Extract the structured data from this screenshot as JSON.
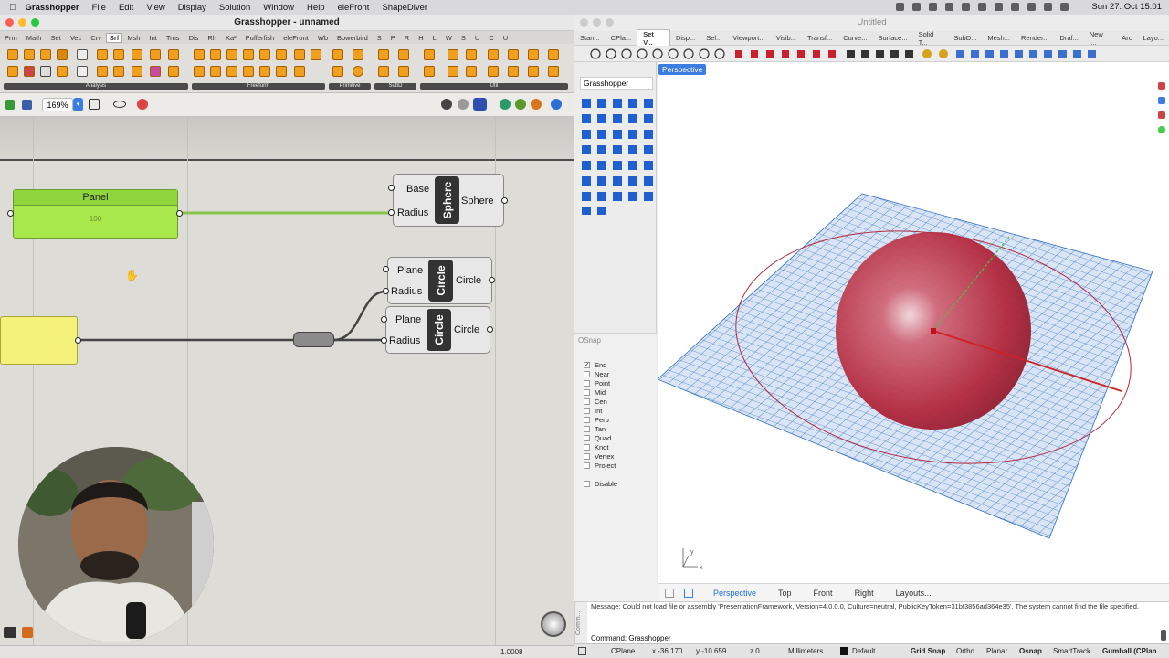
{
  "menubar": {
    "app": "Grasshopper",
    "items": [
      "File",
      "Edit",
      "View",
      "Display",
      "Solution",
      "Window",
      "Help",
      "eleFront",
      "ShapeDiver"
    ],
    "clock": "Sun 27. Oct  15:01"
  },
  "gh": {
    "title": "Grasshopper - unnamed",
    "tabs": [
      "Prm",
      "Math",
      "Set",
      "Vec",
      "Crv",
      "Srf",
      "Msh",
      "Int",
      "Trns",
      "Dis",
      "Rh",
      "Ka²",
      "Pufferfish",
      "eleFront",
      "Wb",
      "Bowerbird",
      "S",
      "P",
      "R",
      "H",
      "L",
      "W",
      "S",
      "U",
      "C",
      "U"
    ],
    "active_tab": "Srf",
    "ribbon_groups": [
      "Analysis",
      "Freeform",
      "Primitive",
      "SubD",
      "Util"
    ],
    "zoom": "169%",
    "status_value": "1.0008",
    "panel": {
      "title": "Panel",
      "value": "100"
    },
    "sphere_node": {
      "inputs": [
        "Base",
        "Radius"
      ],
      "name": "Sphere",
      "output": "Sphere"
    },
    "circle_node_1": {
      "inputs": [
        "Plane",
        "Radius"
      ],
      "name": "Circle",
      "output": "Circle"
    },
    "circle_node_2": {
      "inputs": [
        "Plane",
        "Radius"
      ],
      "name": "Circle",
      "output": "Circle"
    }
  },
  "rhino": {
    "title": "Untitled",
    "tabs": [
      "Stan...",
      "CPla...",
      "Set V...",
      "Disp...",
      "Sel...",
      "Viewport...",
      "Visib...",
      "Transf...",
      "Curve...",
      "Surface...",
      "Solid T...",
      "SubD...",
      "Mesh...",
      "Render...",
      "Draf...",
      "New i...",
      "Arc",
      "Layo..."
    ],
    "active_tab": "Set V...",
    "side_label": "Grasshopper",
    "viewport_label": "Perspective",
    "osnap": {
      "title": "OSnap",
      "items": [
        {
          "label": "End",
          "checked": true
        },
        {
          "label": "Near",
          "checked": false
        },
        {
          "label": "Point",
          "checked": false
        },
        {
          "label": "Mid",
          "checked": false
        },
        {
          "label": "Cen",
          "checked": false
        },
        {
          "label": "Int",
          "checked": false
        },
        {
          "label": "Perp",
          "checked": false
        },
        {
          "label": "Tan",
          "checked": false
        },
        {
          "label": "Quad",
          "checked": false
        },
        {
          "label": "Knot",
          "checked": false
        },
        {
          "label": "Vertex",
          "checked": false
        },
        {
          "label": "Project",
          "checked": false
        }
      ],
      "disable": "Disable"
    },
    "view_tabs": [
      "Perspective",
      "Top",
      "Front",
      "Right",
      "Layouts..."
    ],
    "active_view": "Perspective",
    "command_message": "Message: Could not load file or assembly 'PresentationFramework, Version=4.0.0.0, Culture=neutral, PublicKeyToken=31bf3856ad364e35'. The system cannot find the file specified.",
    "command_line": "Command: Grasshopper",
    "command_tab": "Comm...",
    "status": {
      "cplane": "CPlane",
      "x": "x -36.170",
      "y": "y -10.659",
      "z": "z 0",
      "units": "Millimeters",
      "layer": "Default",
      "toggles": [
        "Grid Snap",
        "Ortho",
        "Planar",
        "Osnap",
        "SmartTrack",
        "Gumball (CPlan"
      ]
    }
  },
  "colors": {
    "panel_green": "#a8e84a",
    "panel_yellow": "#f4f27a",
    "sphere_red": "#b3283c",
    "grid_blue": "#2f6fc6",
    "accent_blue": "#1d6fe0"
  }
}
